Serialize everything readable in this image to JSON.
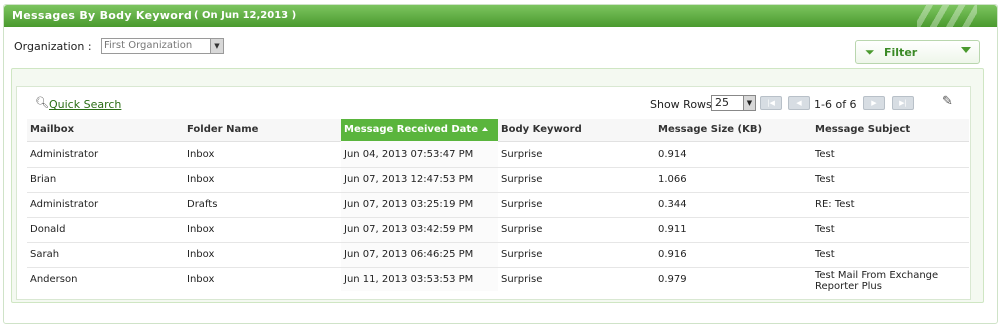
{
  "header": {
    "title": "Messages By Body Keyword",
    "subtitle": "( On Jun 12,2013 )"
  },
  "organization": {
    "label": "Organization :",
    "value": "First Organization"
  },
  "filter": {
    "label": "Filter"
  },
  "toolbar": {
    "quick_search": "Quick Search",
    "show_rows_label": "Show Rows",
    "show_rows_value": "25",
    "page_info": "1-6 of 6"
  },
  "table": {
    "columns": [
      "Mailbox",
      "Folder Name",
      "Message Received Date",
      "Body Keyword",
      "Message Size (KB)",
      "Message Subject"
    ],
    "sorted_column": "Message Received Date",
    "rows": [
      [
        "Administrator",
        "Inbox",
        "Jun 04, 2013 07:53:47 PM",
        "Surprise",
        "0.914",
        "Test"
      ],
      [
        "Brian",
        "Inbox",
        "Jun 07, 2013 12:47:53 PM",
        "Surprise",
        "1.066",
        "Test"
      ],
      [
        "Administrator",
        "Drafts",
        "Jun 07, 2013 03:25:19 PM",
        "Surprise",
        "0.344",
        "RE: Test"
      ],
      [
        "Donald",
        "Inbox",
        "Jun 07, 2013 03:42:59 PM",
        "Surprise",
        "0.911",
        "Test"
      ],
      [
        "Sarah",
        "Inbox",
        "Jun 07, 2013 06:46:25 PM",
        "Surprise",
        "0.916",
        "Test"
      ],
      [
        "Anderson",
        "Inbox",
        "Jun 11, 2013 03:53:53 PM",
        "Surprise",
        "0.979",
        "Test Mail From Exchange Reporter Plus"
      ]
    ]
  },
  "colors": {
    "brand_green": "#4a9a2e",
    "sorted_header": "#5ab53d"
  }
}
